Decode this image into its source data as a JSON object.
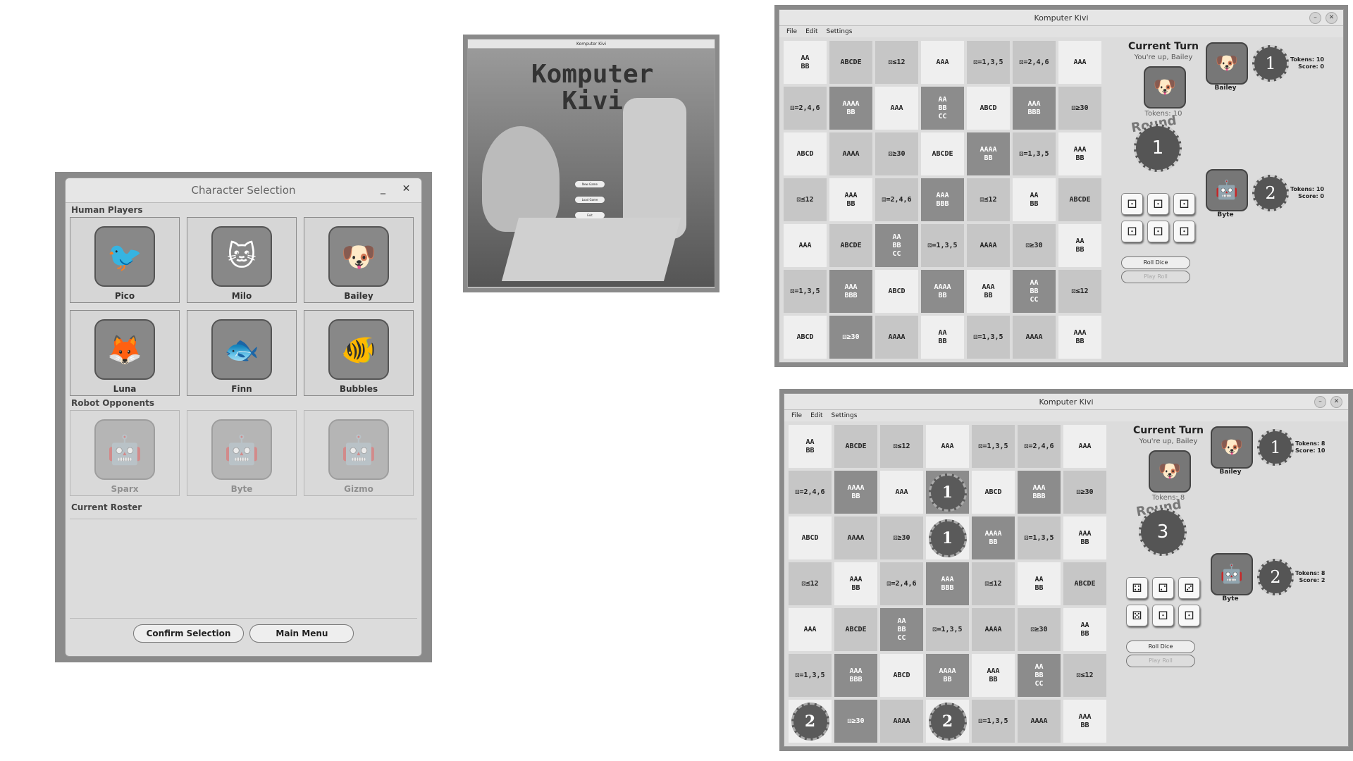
{
  "charsel": {
    "title": "Character Selection",
    "min": "_",
    "close": "✕",
    "human_label": "Human Players",
    "humans": [
      {
        "name": "Pico",
        "icon": "🐦"
      },
      {
        "name": "Milo",
        "icon": "🐱"
      },
      {
        "name": "Bailey",
        "icon": "🐶"
      },
      {
        "name": "Luna",
        "icon": "🦊"
      },
      {
        "name": "Finn",
        "icon": "🐟"
      },
      {
        "name": "Bubbles",
        "icon": "🐠"
      }
    ],
    "robot_label": "Robot Opponents",
    "robots": [
      {
        "name": "Sparx",
        "icon": "🤖"
      },
      {
        "name": "Byte",
        "icon": "🤖"
      },
      {
        "name": "Gizmo",
        "icon": "🤖"
      }
    ],
    "roster_label": "Current Roster",
    "confirm": "Confirm Selection",
    "main_menu": "Main Menu"
  },
  "splash": {
    "title": "Komputer Kivi",
    "logo_line1": "Komputer",
    "logo_line2": "Kivi",
    "btn_new": "New Game",
    "btn_load": "Load Game",
    "btn_exit": "Exit"
  },
  "game1": {
    "title": "Komputer Kivi",
    "menu": [
      "File",
      "Edit",
      "Settings"
    ],
    "current_turn": "Current Turn",
    "youre_up": "You're up, Bailey",
    "tokens_label": "Tokens: 10",
    "round_word": "Round",
    "round_num": "1",
    "p1_name": "Bailey",
    "p1_token": "1",
    "p1_tokens": "Tokens: 10",
    "p1_score": "Score: 0",
    "p2_name": "Byte",
    "p2_token": "2",
    "p2_tokens": "Tokens: 10",
    "p2_score": "Score: 0",
    "dice": [
      "⚀",
      "⚀",
      "⚀",
      "⚀",
      "⚀",
      "⚀"
    ],
    "roll": "Roll Dice",
    "play": "Play Roll"
  },
  "game2": {
    "title": "Komputer Kivi",
    "menu": [
      "File",
      "Edit",
      "Settings"
    ],
    "current_turn": "Current Turn",
    "youre_up": "You're up, Bailey",
    "tokens_label": "Tokens: 8",
    "round_word": "Round",
    "round_num": "3",
    "p1_name": "Bailey",
    "p1_token": "1",
    "p1_tokens": "Tokens: 8",
    "p1_score": "Score: 10",
    "p2_name": "Byte",
    "p2_token": "2",
    "p2_tokens": "Tokens: 8",
    "p2_score": "Score: 2",
    "dice": [
      "⚃",
      "⚁",
      "⚂",
      "⚄",
      "⚀",
      "⚀"
    ],
    "roll": "Roll Dice",
    "play": "Play Roll"
  },
  "board": [
    [
      "AA\nBB",
      "ABCDE",
      "⚄≤12",
      "AAA",
      "⚄=1,3,5",
      "⚄=2,4,6",
      "AAA"
    ],
    [
      "⚄=2,4,6",
      "AAAA\nBB",
      "AAA",
      "AA\nBB\nCC",
      "ABCD",
      "AAA\nBBB",
      "⚄≥30"
    ],
    [
      "ABCD",
      "AAAA",
      "⚄≥30",
      "ABCDE",
      "AAAA\nBB",
      "⚄=1,3,5",
      "AAA\nBB"
    ],
    [
      "⚄≤12",
      "AAA\nBB",
      "⚄=2,4,6",
      "AAA\nBBB",
      "⚄≤12",
      "AA\nBB",
      "ABCDE"
    ],
    [
      "AAA",
      "ABCDE",
      "AA\nBB\nCC",
      "⚄=1,3,5",
      "AAAA",
      "⚄≥30",
      "AA\nBB"
    ],
    [
      "⚄=1,3,5",
      "AAA\nBBB",
      "ABCD",
      "AAAA\nBB",
      "AAA\nBB",
      "AA\nBB\nCC",
      "⚄≤12"
    ],
    [
      "ABCD",
      "⚄≥30",
      "AAAA",
      "AA\nBB",
      "⚄=1,3,5",
      "AAAA",
      "AAA\nBB"
    ]
  ],
  "board_shade": [
    [
      "",
      "mid",
      "mid",
      "",
      "mid",
      "mid",
      ""
    ],
    [
      "mid",
      "dark",
      "",
      "dark",
      "",
      "dark",
      "mid"
    ],
    [
      "",
      "mid",
      "mid",
      "",
      "dark",
      "mid",
      ""
    ],
    [
      "mid",
      "",
      "mid",
      "dark",
      "mid",
      "",
      "mid"
    ],
    [
      "",
      "mid",
      "dark",
      "mid",
      "mid",
      "mid",
      ""
    ],
    [
      "mid",
      "dark",
      "",
      "dark",
      "",
      "dark",
      "mid"
    ],
    [
      "",
      "dark",
      "mid",
      "",
      "mid",
      "mid",
      ""
    ]
  ],
  "tokens2": [
    {
      "r": 1,
      "c": 3,
      "t": "1"
    },
    {
      "r": 2,
      "c": 3,
      "t": "1"
    },
    {
      "r": 6,
      "c": 0,
      "t": "2"
    },
    {
      "r": 6,
      "c": 3,
      "t": "2"
    }
  ]
}
